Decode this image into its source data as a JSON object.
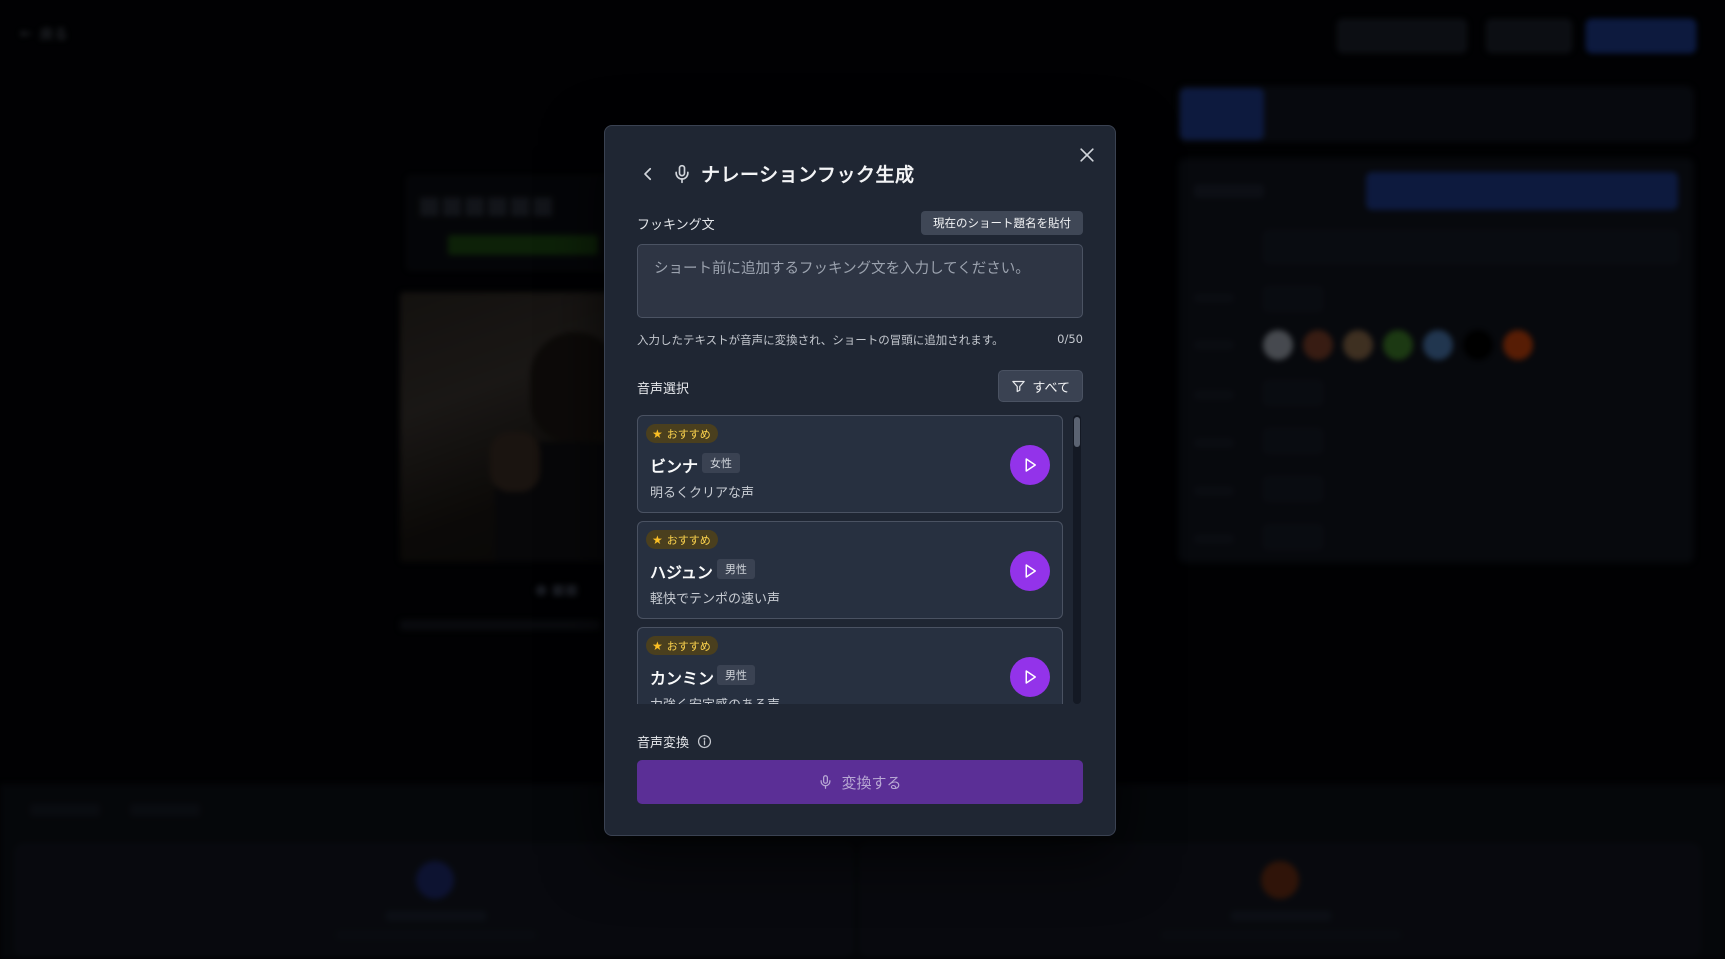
{
  "modal": {
    "title": "ナレーションフック生成",
    "hook_label": "フッキング文",
    "paste_button": "現在のショート題名を貼付",
    "hook_placeholder": "ショート前に追加するフッキング文を入力してください。",
    "hook_value": "",
    "helper_text": "入力したテキストが音声に変換され、ショートの冒頭に追加されます。",
    "char_counter": "0/50",
    "voice_label": "音声選択",
    "filter_label": "すべて",
    "voices": [
      {
        "badge": "おすすめ",
        "name": "ビンナ",
        "gender": "女性",
        "description": "明るくクリアな声"
      },
      {
        "badge": "おすすめ",
        "name": "ハジュン",
        "gender": "男性",
        "description": "軽快でテンポの速い声"
      },
      {
        "badge": "おすすめ",
        "name": "カンミン",
        "gender": "男性",
        "description": "力強く安定感のある声"
      }
    ],
    "convert_label": "音声変換",
    "convert_button": "変換する"
  },
  "background": {
    "back_label": "戻る",
    "swatch_colors": [
      "#9ca3af",
      "#7c3f2a",
      "#8a6a4a",
      "#3f7f2a",
      "#4a78b0",
      "#000000",
      "#c2410c"
    ]
  },
  "colors": {
    "accent_purple": "#9333ea",
    "convert_button": "#5b2f96",
    "recommend_badge": "#fcd34d"
  },
  "icons": {
    "back": "chevron-left-icon",
    "mic": "microphone-icon",
    "close": "close-icon",
    "filter": "filter-icon",
    "star": "star-icon",
    "play": "play-icon",
    "info": "info-icon"
  }
}
